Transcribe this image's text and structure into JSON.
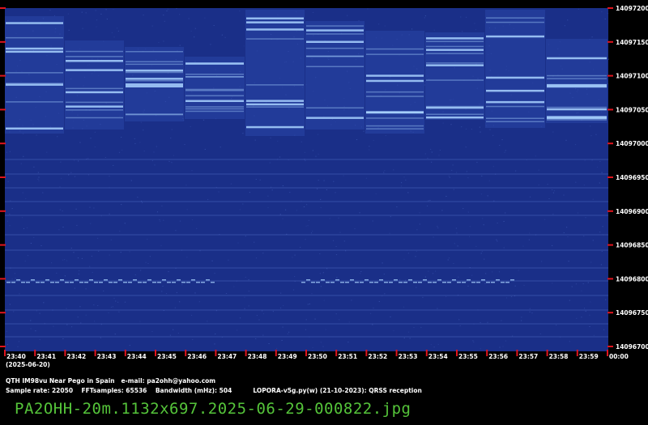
{
  "spectrogram": {
    "frequency_labels": [
      "14097200",
      "14097150",
      "14097100",
      "14097050",
      "14097000",
      "14096950",
      "14096900",
      "14096850",
      "14096800",
      "14096750",
      "14096700"
    ],
    "time_labels": [
      "23:40",
      "23:41",
      "23:42",
      "23:43",
      "23:44",
      "23:45",
      "23:46",
      "23:47",
      "23:48",
      "23:49",
      "23:50",
      "23:51",
      "23:52",
      "23:53",
      "23:54",
      "23:55",
      "23:56",
      "23:57",
      "23:58",
      "23:59",
      "00:00"
    ],
    "date": "(2025-06-20)",
    "colors": {
      "background": "#1a2f88",
      "signal": "#a9d4ff",
      "marker": "#e0141e",
      "text": "#ffffff"
    }
  },
  "info": {
    "line1": "QTH IM98vu Near Pego in Spain   e-mail: pa2ohh@yahoo.com",
    "line2": "Sample rate: 22050    FFTsamples: 65536    Bandwidth (mHz): 504          LOPORA-v5g.py(w) (21-10-2023): QRSS reception"
  },
  "filename": "PA2OHH-20m.1132x697.2025-06-29-000822.jpg"
}
